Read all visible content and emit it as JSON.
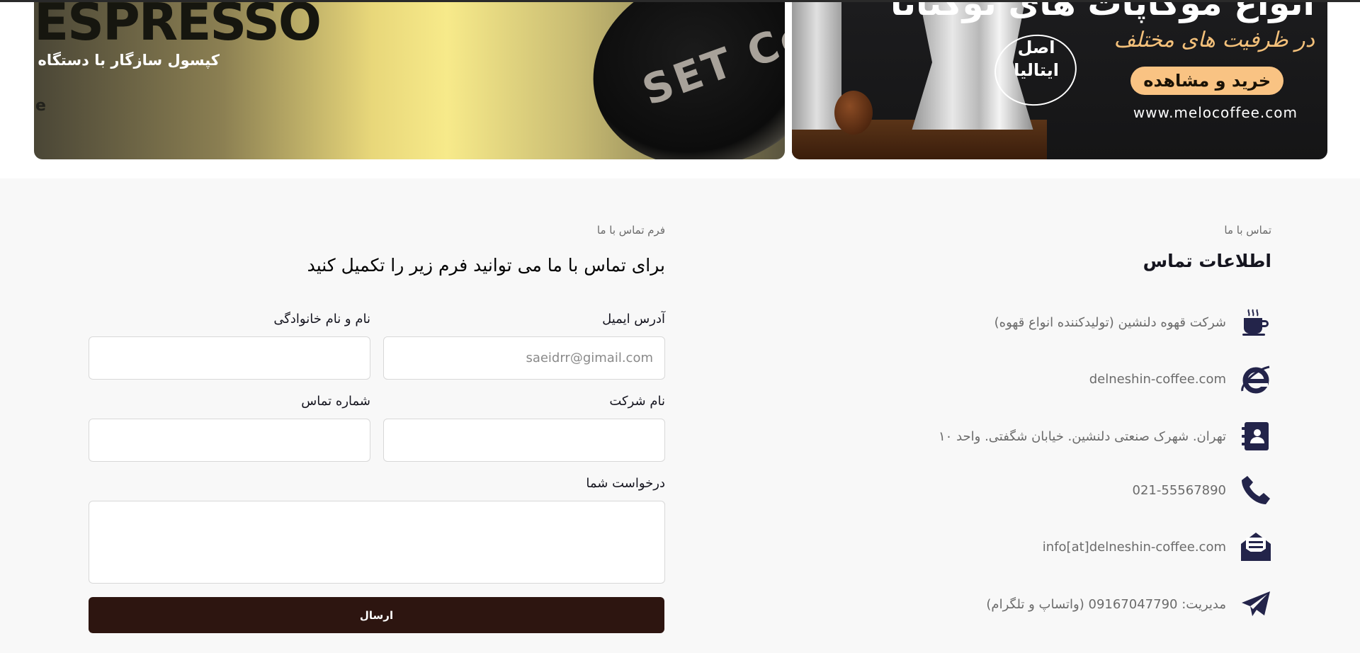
{
  "banners": {
    "left": {
      "brand_text": "ESPRESSO",
      "caption": "کپسول سازگار با دستگاه",
      "small_text": "e",
      "capsule_label": "SET Coffee"
    },
    "right": {
      "heading": "انواع موکاپات های توگنانا",
      "subheading": "در ظرفیت های مختلف",
      "badge": "اصل ایتالیا",
      "button_label": "خرید و مشاهده",
      "url": "www.melocoffee.com"
    }
  },
  "contact_info": {
    "label": "تماس با ما",
    "title": "اطلاعات تماس",
    "items": [
      {
        "icon": "coffee-cup-icon",
        "text": "شرکت قهوه دلنشین (تولیدکننده انواع قهوه)"
      },
      {
        "icon": "internet-explorer-icon",
        "text": "delneshin-coffee.com"
      },
      {
        "icon": "address-book-icon",
        "text": "تهران. شهرک صنعتی دلنشین. خیابان شگفتی. واحد ۱۰"
      },
      {
        "icon": "phone-icon",
        "text": "021-55567890"
      },
      {
        "icon": "envelope-open-icon",
        "text": "info[at]delneshin-coffee.com"
      },
      {
        "icon": "paper-plane-icon",
        "text": "مدیریت: 09167047790 (واتساپ و تلگرام)"
      }
    ]
  },
  "contact_form": {
    "label": "فرم تماس با ما",
    "title": "برای تماس با ما می توانید فرم زیر را تکمیل کنید",
    "email_label": "آدرس ایمیل",
    "email_placeholder": "saeidrr@gimail.com",
    "name_label": "نام و نام خانوادگی",
    "company_label": "نام شرکت",
    "phone_label": "شماره تماس",
    "request_label": "درخواست شما",
    "submit_label": "ارسال"
  },
  "colors": {
    "icon": "#23244a",
    "submit_bg": "#2d1510",
    "cta_bg": "#f9c383"
  }
}
